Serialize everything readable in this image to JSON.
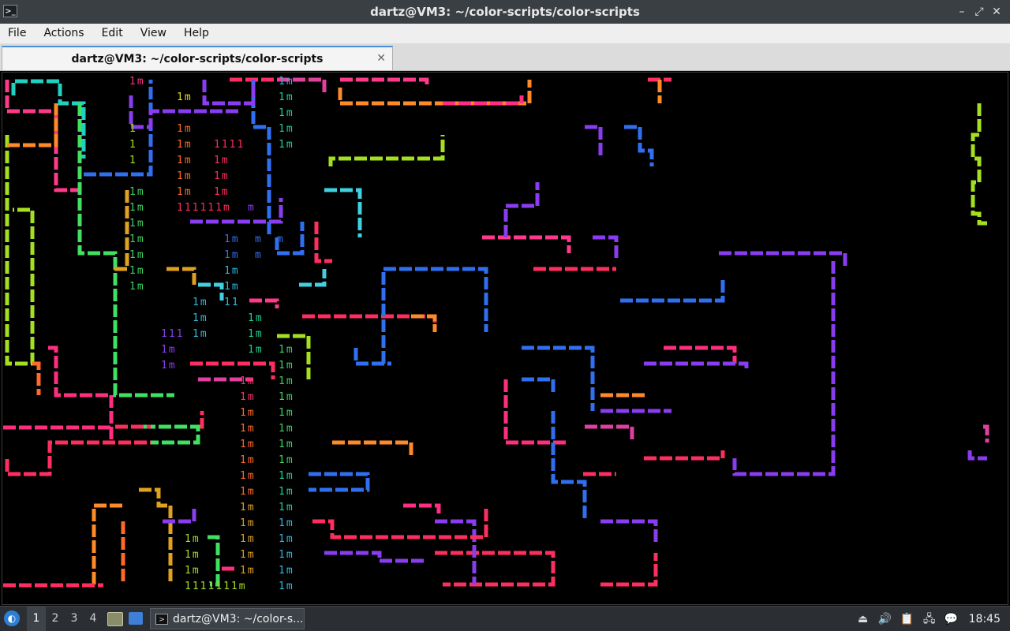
{
  "window": {
    "title": "dartz@VM3: ~/color-scripts/color-scripts",
    "icon": "terminal-icon",
    "controls": {
      "minimize": "–",
      "maximize": "⤢",
      "close": "✕"
    }
  },
  "menu": [
    "File",
    "Actions",
    "Edit",
    "View",
    "Help"
  ],
  "tab": {
    "label": "dartz@VM3: ~/color-scripts/color-scripts",
    "close": "✕"
  },
  "terminal": {
    "background": "#000000",
    "text_fragments": [
      {
        "t": "1m",
        "c": "#ff2e88",
        "col": 163,
        "row": 101
      },
      {
        "t": "1m",
        "c": "#e0e020",
        "col": 223,
        "row": 121
      },
      {
        "t": "1",
        "c": "#a4e020",
        "col": 163,
        "row": 161
      },
      {
        "t": "1m",
        "c": "#ff6a2a",
        "col": 223,
        "row": 161
      },
      {
        "t": "1",
        "c": "#a4e020",
        "col": 163,
        "row": 181
      },
      {
        "t": "1m",
        "c": "#ff6a2a",
        "col": 223,
        "row": 181
      },
      {
        "t": "1111",
        "c": "#ff2e60",
        "col": 270,
        "row": 181
      },
      {
        "t": "1",
        "c": "#a4e020",
        "col": 163,
        "row": 201
      },
      {
        "t": "1m",
        "c": "#ff6a2a",
        "col": 223,
        "row": 201
      },
      {
        "t": "1m",
        "c": "#ff2e60",
        "col": 270,
        "row": 201
      },
      {
        "t": "1m",
        "c": "#ff6a2a",
        "col": 223,
        "row": 221
      },
      {
        "t": "1m",
        "c": "#ff2e60",
        "col": 270,
        "row": 221
      },
      {
        "t": "1m",
        "c": "#ff6a2a",
        "col": 223,
        "row": 241
      },
      {
        "t": "1m",
        "c": "#ff2e60",
        "col": 270,
        "row": 241
      },
      {
        "t": "111111m",
        "c": "#ff2e60",
        "col": 223,
        "row": 261
      },
      {
        "t": "m",
        "c": "#8a3cf0",
        "col": 313,
        "row": 261
      },
      {
        "t": "1m",
        "c": "#40d060",
        "col": 163,
        "row": 241
      },
      {
        "t": "1m",
        "c": "#40d060",
        "col": 163,
        "row": 261
      },
      {
        "t": "1m",
        "c": "#40d060",
        "col": 163,
        "row": 281
      },
      {
        "t": "1m",
        "c": "#40d060",
        "col": 163,
        "row": 301
      },
      {
        "t": "1m",
        "c": "#40d060",
        "col": 163,
        "row": 321
      },
      {
        "t": "1m",
        "c": "#40d060",
        "col": 163,
        "row": 341
      },
      {
        "t": "1m",
        "c": "#40d060",
        "col": 163,
        "row": 361
      },
      {
        "t": "1m",
        "c": "#2eb8e0",
        "col": 352,
        "row": 101
      },
      {
        "t": "1m",
        "c": "#20d090",
        "col": 352,
        "row": 121
      },
      {
        "t": "1m",
        "c": "#20d090",
        "col": 352,
        "row": 141
      },
      {
        "t": "1m",
        "c": "#20d090",
        "col": 352,
        "row": 161
      },
      {
        "t": "1m",
        "c": "#20d090",
        "col": 352,
        "row": 181
      },
      {
        "t": "1m",
        "c": "#3070f0",
        "col": 283,
        "row": 301
      },
      {
        "t": "m",
        "c": "#3070f0",
        "col": 322,
        "row": 301
      },
      {
        "t": "m",
        "c": "#3070f0",
        "col": 350,
        "row": 301
      },
      {
        "t": "1m",
        "c": "#3070f0",
        "col": 283,
        "row": 321
      },
      {
        "t": "m",
        "c": "#3070f0",
        "col": 322,
        "row": 321
      },
      {
        "t": "1m",
        "c": "#2eb8e0",
        "col": 283,
        "row": 341
      },
      {
        "t": "1m",
        "c": "#2eb8e0",
        "col": 283,
        "row": 361
      },
      {
        "t": "1m",
        "c": "#2eb8e0",
        "col": 243,
        "row": 381
      },
      {
        "t": "11",
        "c": "#2eb8e0",
        "col": 283,
        "row": 381
      },
      {
        "t": "1m",
        "c": "#2eb8e0",
        "col": 243,
        "row": 401
      },
      {
        "t": "1m",
        "c": "#20d090",
        "col": 313,
        "row": 401
      },
      {
        "t": "111",
        "c": "#8a3cf0",
        "col": 203,
        "row": 421
      },
      {
        "t": "1m",
        "c": "#2eb8e0",
        "col": 243,
        "row": 421
      },
      {
        "t": "1m",
        "c": "#20d090",
        "col": 313,
        "row": 421
      },
      {
        "t": "1m",
        "c": "#8a3cf0",
        "col": 203,
        "row": 441
      },
      {
        "t": "1m",
        "c": "#20d090",
        "col": 313,
        "row": 441
      },
      {
        "t": "1m",
        "c": "#8a3cf0",
        "col": 203,
        "row": 461
      },
      {
        "t": "1m",
        "c": "#40d060",
        "col": 352,
        "row": 441
      },
      {
        "t": "1m",
        "c": "#40d060",
        "col": 352,
        "row": 461
      },
      {
        "t": "1m",
        "c": "#40d060",
        "col": 352,
        "row": 481
      },
      {
        "t": "1m",
        "c": "#ff2e60",
        "col": 303,
        "row": 481
      },
      {
        "t": "1m",
        "c": "#ff2e60",
        "col": 303,
        "row": 501
      },
      {
        "t": "1m",
        "c": "#40d060",
        "col": 352,
        "row": 501
      },
      {
        "t": "1m",
        "c": "#ff6a2a",
        "col": 303,
        "row": 521
      },
      {
        "t": "1m",
        "c": "#40d060",
        "col": 352,
        "row": 521
      },
      {
        "t": "1m",
        "c": "#ff6a2a",
        "col": 303,
        "row": 541
      },
      {
        "t": "1m",
        "c": "#40d060",
        "col": 352,
        "row": 541
      },
      {
        "t": "1m",
        "c": "#ff6a2a",
        "col": 303,
        "row": 561
      },
      {
        "t": "1m",
        "c": "#40d060",
        "col": 352,
        "row": 561
      },
      {
        "t": "1m",
        "c": "#ff6a2a",
        "col": 303,
        "row": 581
      },
      {
        "t": "1m",
        "c": "#40d060",
        "col": 352,
        "row": 581
      },
      {
        "t": "1m",
        "c": "#ff6a2a",
        "col": 303,
        "row": 601
      },
      {
        "t": "1m",
        "c": "#20d090",
        "col": 352,
        "row": 601
      },
      {
        "t": "1m",
        "c": "#ff6a2a",
        "col": 303,
        "row": 621
      },
      {
        "t": "1m",
        "c": "#20d090",
        "col": 352,
        "row": 621
      },
      {
        "t": "1m",
        "c": "#e0a020",
        "col": 303,
        "row": 641
      },
      {
        "t": "1m",
        "c": "#20d090",
        "col": 352,
        "row": 641
      },
      {
        "t": "1m",
        "c": "#e0a020",
        "col": 303,
        "row": 661
      },
      {
        "t": "1m",
        "c": "#2eb8e0",
        "col": 352,
        "row": 661
      },
      {
        "t": "1m",
        "c": "#a4e020",
        "col": 233,
        "row": 681
      },
      {
        "t": "1m",
        "c": "#e0a020",
        "col": 303,
        "row": 681
      },
      {
        "t": "1m",
        "c": "#2eb8e0",
        "col": 352,
        "row": 681
      },
      {
        "t": "1m",
        "c": "#a4e020",
        "col": 233,
        "row": 701
      },
      {
        "t": "1m",
        "c": "#e0a020",
        "col": 303,
        "row": 701
      },
      {
        "t": "1m",
        "c": "#2eb8e0",
        "col": 352,
        "row": 701
      },
      {
        "t": "1m",
        "c": "#a4e020",
        "col": 233,
        "row": 721
      },
      {
        "t": "1m",
        "c": "#e0a020",
        "col": 303,
        "row": 721
      },
      {
        "t": "1m",
        "c": "#2eb8e0",
        "col": 352,
        "row": 721
      },
      {
        "t": "1111111m",
        "c": "#a4e020",
        "col": 233,
        "row": 741
      },
      {
        "t": "1m",
        "c": "#2eb8e0",
        "col": 352,
        "row": 741
      }
    ]
  },
  "taskbar": {
    "desktops": [
      "1",
      "2",
      "3",
      "4"
    ],
    "active_desktop": "1",
    "task_label": "dartz@VM3: ~/color-s...",
    "clock": "18:45",
    "colors": {
      "accent": "#2e7fd0",
      "panel": "#2b2f33"
    }
  }
}
